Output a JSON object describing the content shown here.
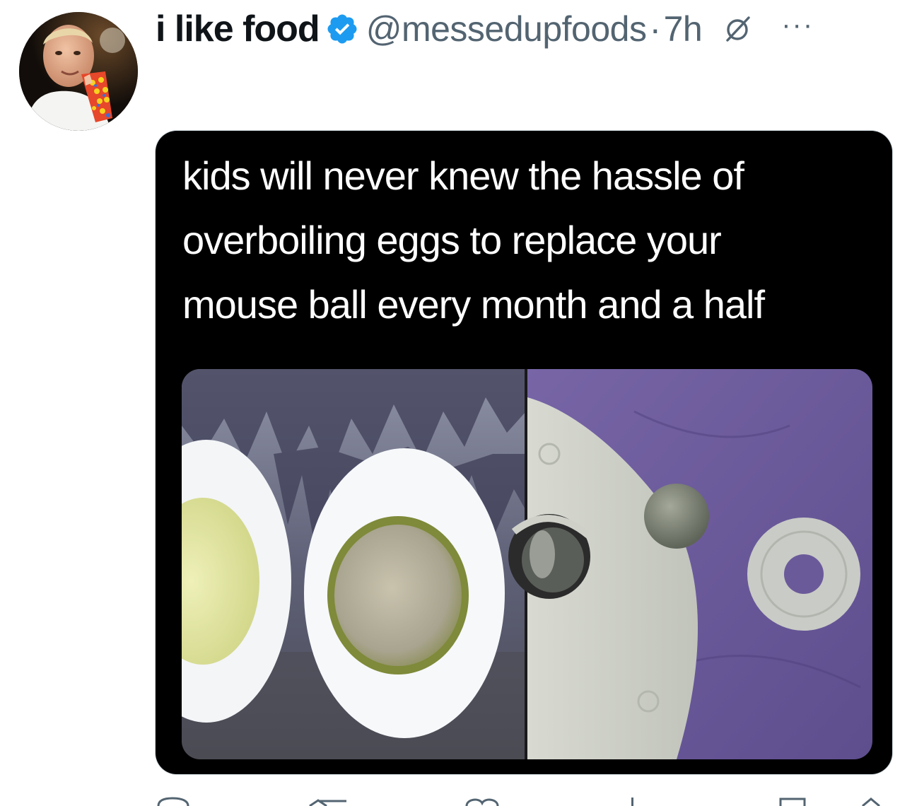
{
  "tweet": {
    "display_name": "i like food",
    "handle": "@messedupfoods",
    "separator": "·",
    "time": "7h",
    "more_label": "···"
  },
  "media": {
    "caption_lines": [
      "kids will never knew the hassle of",
      "overboiling eggs to replace your",
      "mouse ball every month and a half"
    ]
  },
  "icons": {
    "verified": "verified-badge-icon",
    "grok": "grok-icon",
    "more": "more-options-icon"
  },
  "colors": {
    "verified": "#1d9bf0",
    "secondary_text": "#536471",
    "primary_text": "#0f1419"
  }
}
